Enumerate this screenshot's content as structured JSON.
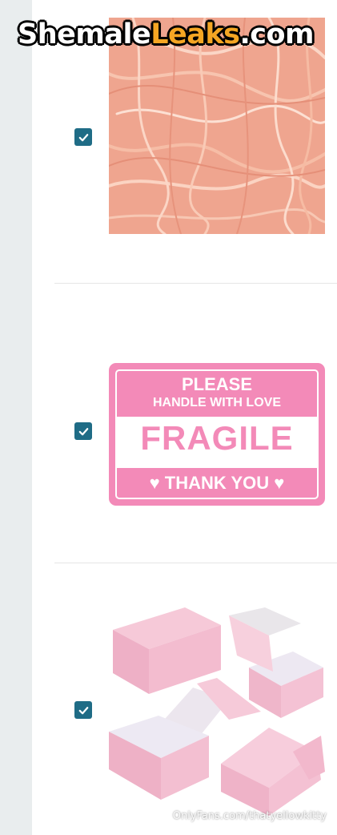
{
  "logo": {
    "part1": "Shemale",
    "part2": "Leaks",
    "part3": ".com"
  },
  "items": [
    {
      "name": "shredded paper",
      "checked": true
    },
    {
      "name": "fragile sticker",
      "checked": true,
      "label": {
        "line1": "PLEASE",
        "line2": "HANDLE WITH LOVE",
        "line3": "FRAGILE",
        "line4": "♥ THANK YOU ♥"
      }
    },
    {
      "name": "pink mailer boxes",
      "checked": true
    }
  ],
  "watermark": "OnlyFans.com/thatyellowkitty",
  "colors": {
    "checkbox": "#1f6c86",
    "pink": "#f38ab8",
    "paper": "#f2a892",
    "rail": "#e9edee"
  }
}
